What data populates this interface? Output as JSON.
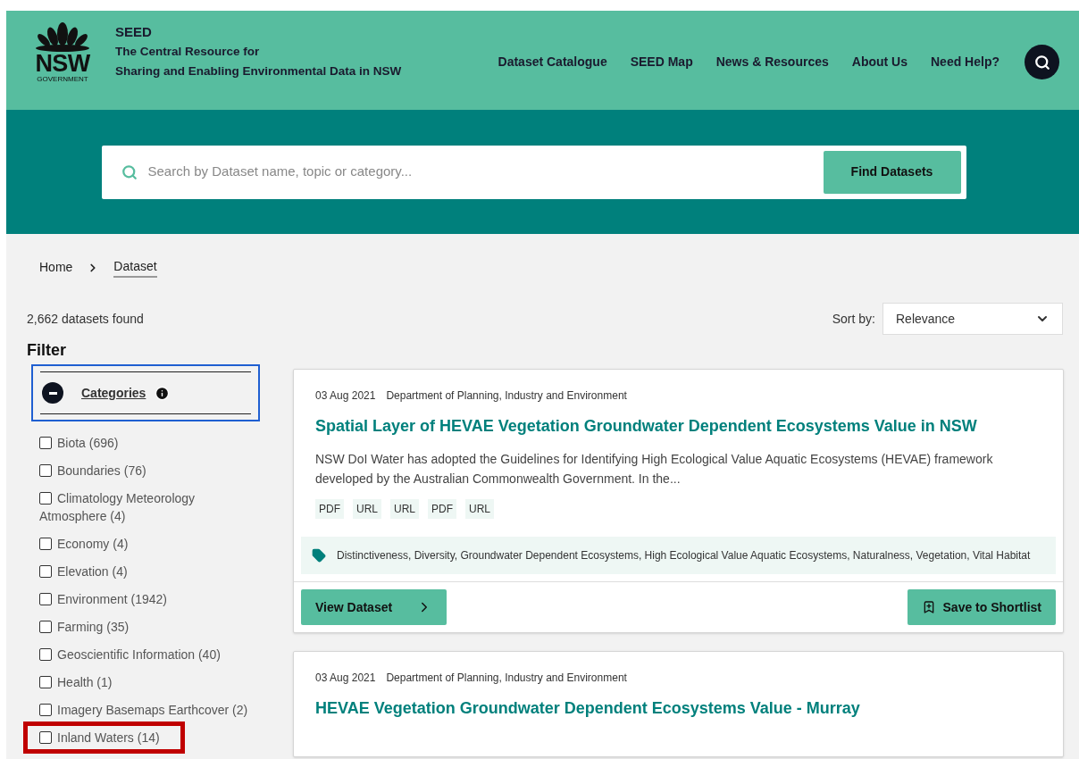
{
  "header": {
    "logo_text": "NSW",
    "logo_subtext": "GOVERNMENT",
    "site_name": "SEED",
    "tagline_1": "The Central Resource for",
    "tagline_2": "Sharing and Enabling Environmental Data in NSW",
    "nav": [
      "Dataset Catalogue",
      "SEED Map",
      "News & Resources",
      "About Us",
      "Need Help?"
    ]
  },
  "search": {
    "placeholder": "Search by Dataset name, topic or category...",
    "button": "Find Datasets"
  },
  "breadcrumb": [
    {
      "label": "Home",
      "current": false
    },
    {
      "label": "Dataset",
      "current": true
    }
  ],
  "results_count": "2,662 datasets found",
  "sort": {
    "label": "Sort by:",
    "value": "Relevance"
  },
  "filter": {
    "title": "Filter",
    "section": "Categories",
    "expanded": true,
    "items": [
      {
        "label": "Biota (696)",
        "checked": false,
        "highlighted": false
      },
      {
        "label": "Boundaries (76)",
        "checked": false,
        "highlighted": false
      },
      {
        "label": "Climatology Meteorology Atmosphere (4)",
        "checked": false,
        "highlighted": false
      },
      {
        "label": "Economy (4)",
        "checked": false,
        "highlighted": false
      },
      {
        "label": "Elevation (4)",
        "checked": false,
        "highlighted": false
      },
      {
        "label": "Environment (1942)",
        "checked": false,
        "highlighted": false
      },
      {
        "label": "Farming (35)",
        "checked": false,
        "highlighted": false
      },
      {
        "label": "Geoscientific Information (40)",
        "checked": false,
        "highlighted": false
      },
      {
        "label": "Health (1)",
        "checked": false,
        "highlighted": false
      },
      {
        "label": "Imagery Basemaps Earthcover (2)",
        "checked": false,
        "highlighted": false
      },
      {
        "label": "Inland Waters (14)",
        "checked": false,
        "highlighted": true
      }
    ]
  },
  "datasets": [
    {
      "date": "03 Aug 2021",
      "publisher": "Department of Planning, Industry and Environment",
      "title": "Spatial Layer of HEVAE Vegetation Groundwater Dependent Ecosystems Value in NSW",
      "description": "NSW DoI Water has adopted the Guidelines for Identifying High Ecological Value Aquatic Ecosystems (HEVAE) framework developed by the Australian Commonwealth Government. In the...",
      "formats": [
        "PDF",
        "URL",
        "URL",
        "PDF",
        "URL"
      ],
      "tags": "Distinctiveness, Diversity, Groundwater Dependent Ecosystems, High Ecological Value Aquatic Ecosystems, Naturalness, Vegetation, Vital Habitat",
      "view_button": "View Dataset",
      "save_button": "Save to Shortlist"
    },
    {
      "date": "03 Aug 2021",
      "publisher": "Department of Planning, Industry and Environment",
      "title": "HEVAE Vegetation Groundwater Dependent Ecosystems Value - Murray"
    }
  ]
}
